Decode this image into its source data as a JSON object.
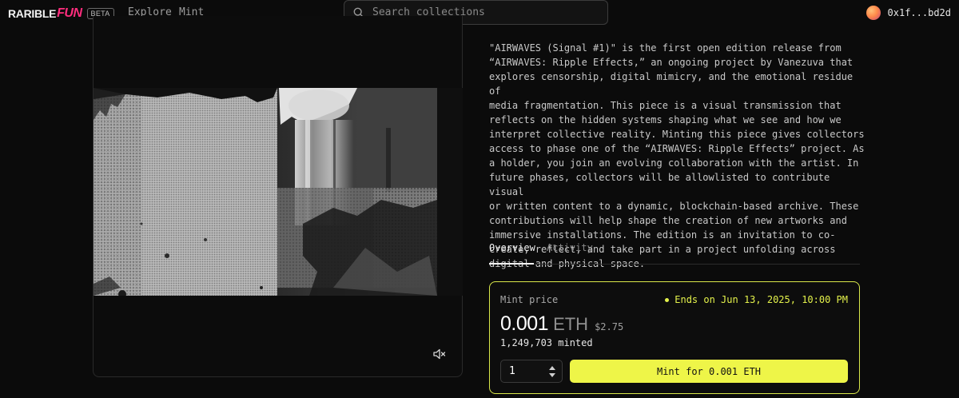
{
  "header": {
    "logo_main": "RARIBLE",
    "logo_fun": "FUN",
    "beta_badge": "BETA",
    "nav": {
      "explore": "Explore",
      "mint": "Mint"
    },
    "search": {
      "placeholder": "Search collections",
      "icon": "search-icon"
    },
    "wallet": {
      "address": "0x1f...bd2d"
    }
  },
  "media": {
    "mute_icon": "speaker-muted-icon"
  },
  "details": {
    "description": "\"AIRWAVES (Signal #1)\" is the first open edition release from\n“AIRWAVES: Ripple Effects,” an ongoing project by Vanezuva that\nexplores censorship, digital mimicry, and the emotional residue of\nmedia fragmentation. This piece is a visual transmission that\nreflects on the hidden systems shaping what we see and how we\ninterpret collective reality. Minting this piece gives collectors\naccess to phase one of the “AIRWAVES: Ripple Effects” project. As\na holder, you join an evolving collaboration with the artist. In\nfuture phases, collectors will be allowlisted to contribute visual\nor written content to a dynamic, blockchain-based archive. These\ncontributions will help shape the creation of new artworks and\nimmersive installations. The edition is an invitation to co-\ncreate, reflect, and take part in a project unfolding across\ndigital and physical space.",
    "tabs": [
      {
        "label": "Overview",
        "active": true
      },
      {
        "label": "Activity",
        "active": false
      }
    ]
  },
  "mint": {
    "label": "Mint price",
    "ends": "Ends on Jun 13, 2025, 10:00 PM",
    "price": "0.001",
    "unit": "ETH",
    "usd": "$2.75",
    "minted": "1,249,703 minted",
    "quantity": "1",
    "button": "Mint for 0.001 ETH"
  },
  "colors": {
    "accent": "#eef548",
    "brand_pink": "#ff2d7d",
    "background": "#0b0b0b"
  }
}
